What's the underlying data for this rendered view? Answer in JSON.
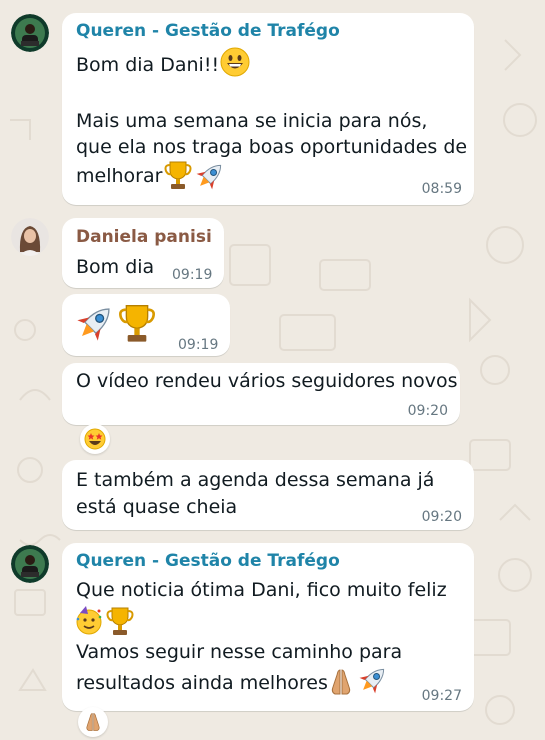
{
  "chat": {
    "colors": {
      "background": "#efeae2",
      "bubble": "#ffffff",
      "queren_name": "#1f84a8",
      "daniela_name": "#8a5a44",
      "timestamp": "#667781"
    },
    "messages": [
      {
        "sender": "Queren - Gestão de Trafégo",
        "line1": "Bom dia Dani!!",
        "line2": "Mais uma semana se inicia para nós,",
        "line3": "que ela nos traga boas oportunidades de",
        "line4": "melhorar",
        "emojis": [
          "grinning-face",
          "trophy",
          "rocket"
        ],
        "time": "08:59"
      },
      {
        "sender": "Daniela panisi",
        "text": "Bom dia",
        "time": "09:19"
      },
      {
        "emojis": [
          "rocket",
          "trophy"
        ],
        "time": "09:19"
      },
      {
        "text": "O vídeo rendeu vários seguidores novos",
        "time": "09:20",
        "reaction": "star-struck"
      },
      {
        "line1": "E também a agenda dessa semana já",
        "line2": "está quase cheia",
        "time": "09:20"
      },
      {
        "sender": "Queren - Gestão de Trafégo",
        "line1": "Que noticia ótima Dani, fico muito feliz",
        "line2": "Vamos seguir nesse caminho para",
        "line3": "resultados ainda melhores",
        "emojis": [
          "partying-face",
          "trophy",
          "folded-hands",
          "rocket"
        ],
        "time": "09:27",
        "reaction": "folded-hands"
      }
    ]
  }
}
